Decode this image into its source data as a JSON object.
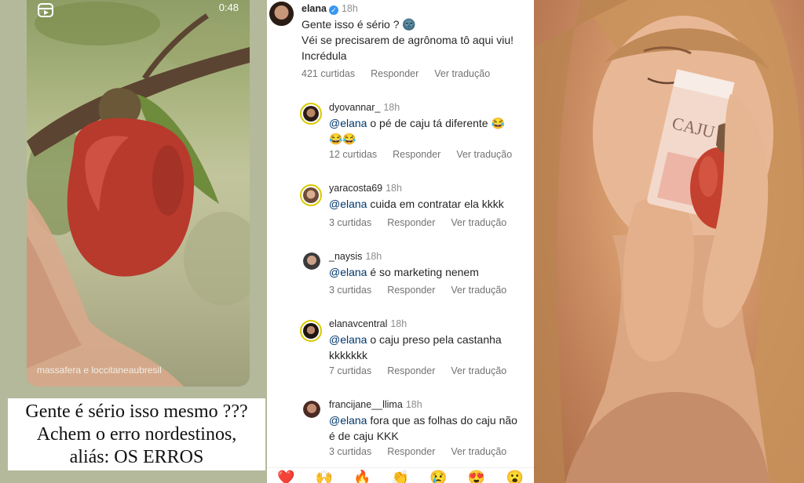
{
  "left_panel": {
    "video_time": "0:48",
    "credit": "massafera e loccitaneaubresil",
    "caption_lines": [
      "Gente é sério isso mesmo ???",
      "Achem o erro nordestinos,",
      "aliás: OS ERROS"
    ]
  },
  "post": {
    "username": "elana",
    "verified": true,
    "time": "18h",
    "lines": [
      "Gente isso é sério ? 🌚",
      "Véi se precisarem de agrônoma tô aqui viu!",
      "Incrédula"
    ],
    "likes": "421 curtidas",
    "reply": "Responder",
    "translate": "Ver tradução"
  },
  "replies": [
    {
      "username": "dyovannar_",
      "time": "18h",
      "mention": "@elana",
      "line1": " o pé de caju tá diferente 😂",
      "line2": "😂😂",
      "likes": "12 curtidas",
      "reply": "Responder",
      "translate": "Ver tradução"
    },
    {
      "username": "yaracosta69",
      "time": "18h",
      "mention": "@elana",
      "line1": " cuida em contratar ela kkkk",
      "line2": "",
      "likes": "3 curtidas",
      "reply": "Responder",
      "translate": "Ver tradução"
    },
    {
      "username": "_naysis",
      "time": "18h",
      "mention": "@elana",
      "line1": " é so marketing nenem",
      "line2": "",
      "likes": "3 curtidas",
      "reply": "Responder",
      "translate": "Ver tradução"
    },
    {
      "username": "elanavcentral",
      "time": "18h",
      "mention": "@elana",
      "line1": " o caju preso pela castanha",
      "line2": "kkkkkkk",
      "likes": "7 curtidas",
      "reply": "Responder",
      "translate": "Ver tradução"
    },
    {
      "username": "francijane__llima",
      "time": "18h",
      "mention": "@elana",
      "line1": " fora que as folhas do caju não",
      "line2": "é de caju KKK",
      "likes": "3 curtidas",
      "reply": "Responder",
      "translate": "Ver tradução"
    }
  ],
  "emoji_bar": [
    "❤️",
    "🙌",
    "🔥",
    "👏",
    "😢",
    "😍",
    "😮"
  ],
  "product_label": "CAJU",
  "colors": {
    "mention": "#00376b",
    "verified": "#3897f0",
    "meta_text": "#737373",
    "story_ring": "#d9c900"
  }
}
